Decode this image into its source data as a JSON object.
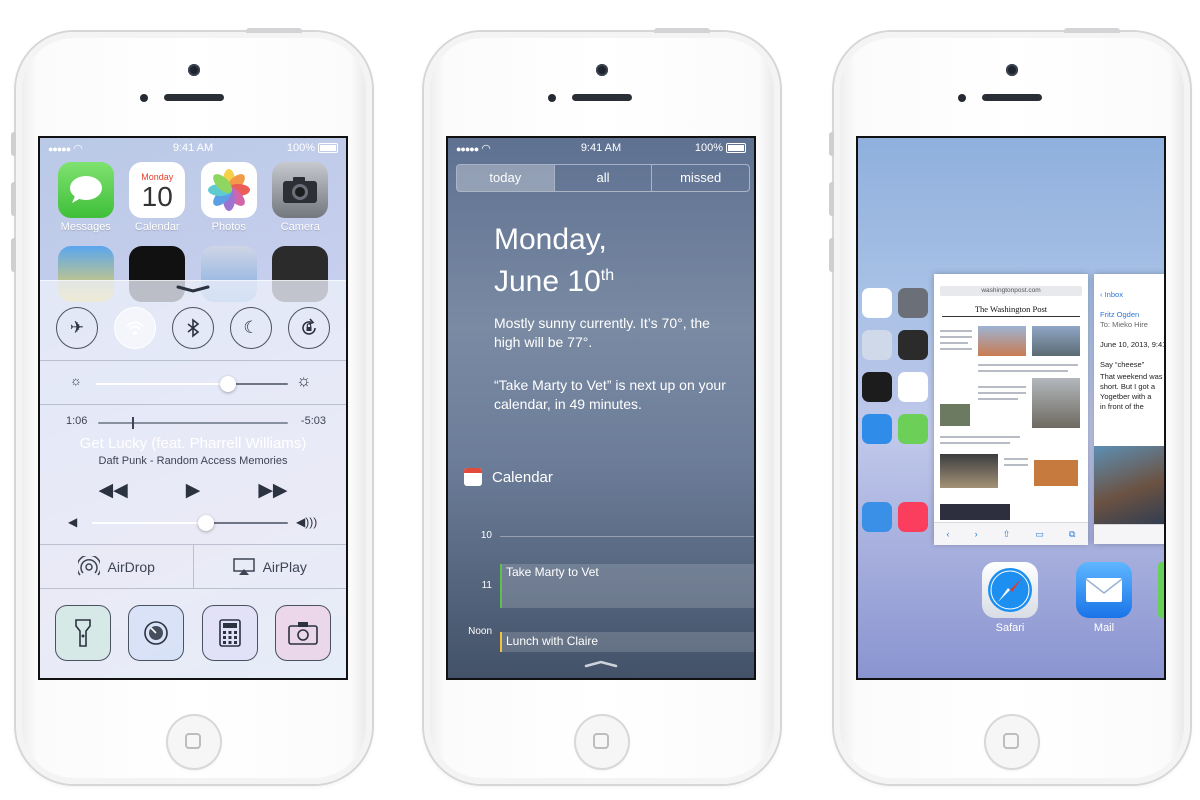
{
  "phone1": {
    "status": {
      "signal": "●●●●●",
      "wifi_icon": "wifi-icon",
      "time": "9:41 AM",
      "battery": "100%"
    },
    "apps": [
      {
        "label": "Messages",
        "icon": "messages-icon",
        "color": "#5ad356"
      },
      {
        "label": "Calendar",
        "icon": "calendar-icon",
        "day": "Monday",
        "date": "10"
      },
      {
        "label": "Photos",
        "icon": "photos-icon"
      },
      {
        "label": "Camera",
        "icon": "camera-icon",
        "color": "#8b8e94"
      }
    ],
    "control_center": {
      "toggles": [
        "airplane-mode-toggle",
        "wifi-toggle",
        "bluetooth-toggle",
        "do-not-disturb-toggle",
        "rotation-lock-toggle"
      ],
      "brightness_level": 0.69,
      "music": {
        "elapsed": "1:06",
        "remaining": "-5:03",
        "progress": 0.18,
        "title": "Get Lucky (feat. Pharrell Williams)",
        "artist": "Daft Punk - Random Access Memories",
        "volume_level": 0.58
      },
      "airdrop_label": "AirDrop",
      "airplay_label": "AirPlay",
      "tools": [
        "flashlight-icon",
        "timer-icon",
        "calculator-icon",
        "camera-icon"
      ]
    }
  },
  "phone2": {
    "status": {
      "signal": "●●●●●",
      "time": "9:41 AM",
      "battery": "100%"
    },
    "tabs": [
      {
        "label": "today",
        "active": true
      },
      {
        "label": "all",
        "active": false
      },
      {
        "label": "missed",
        "active": false
      }
    ],
    "date_line1": "Monday,",
    "date_line2": "June 10",
    "date_suffix": "th",
    "summary_weather": "Mostly sunny currently. It’s 70°, the high will be 77°.",
    "summary_calendar": "“Take Marty to Vet” is next up on your calendar, in 49 minutes.",
    "calendar_heading": "Calendar",
    "hours": [
      "10",
      "11",
      "Noon"
    ],
    "events": [
      {
        "title": "Take Marty to Vet",
        "color": "#5fc04b"
      },
      {
        "title": "Lunch with Claire",
        "color": "#f1c43c"
      }
    ]
  },
  "phone3": {
    "safari_url": "washingtonpost.com",
    "safari_masthead": "The Washington Post",
    "mail": {
      "back": "Inbox",
      "from": "Fritz Ogden",
      "to": "To: Mieko Hire",
      "date": "June 10, 2013, 9:41 PM",
      "body": [
        "Say “cheese”",
        "That weekend was",
        "short. But I got a",
        "Yogetber with a",
        "in front of the"
      ]
    },
    "dock": [
      {
        "label": "Safari",
        "icon": "safari-icon"
      },
      {
        "label": "Mail",
        "icon": "mail-icon"
      }
    ]
  }
}
